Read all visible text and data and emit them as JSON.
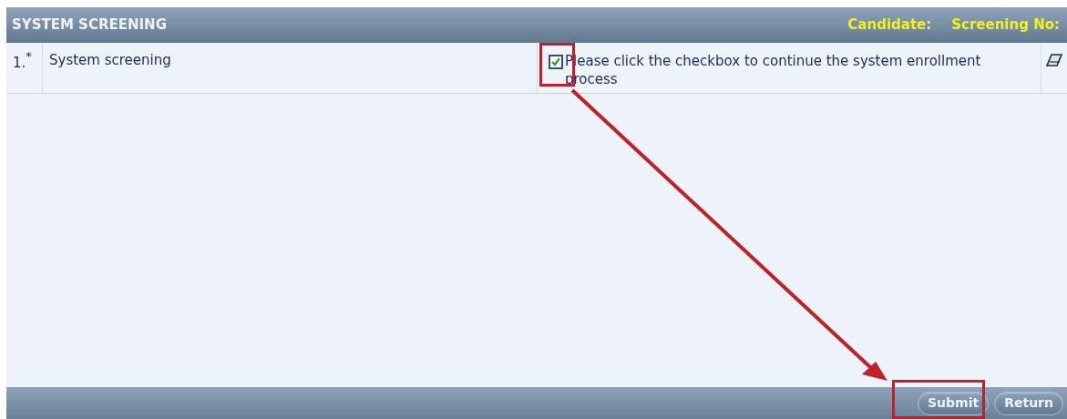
{
  "header": {
    "title": "SYSTEM SCREENING",
    "fields": [
      "Candidate:",
      "Screening No:"
    ]
  },
  "rows": [
    {
      "number": "1.",
      "required_mark": "*",
      "label": "System screening",
      "checked": true,
      "instruction": "Please click the checkbox to continue the system enrollment process"
    }
  ],
  "buttons": [
    "Submit",
    "Return"
  ]
}
